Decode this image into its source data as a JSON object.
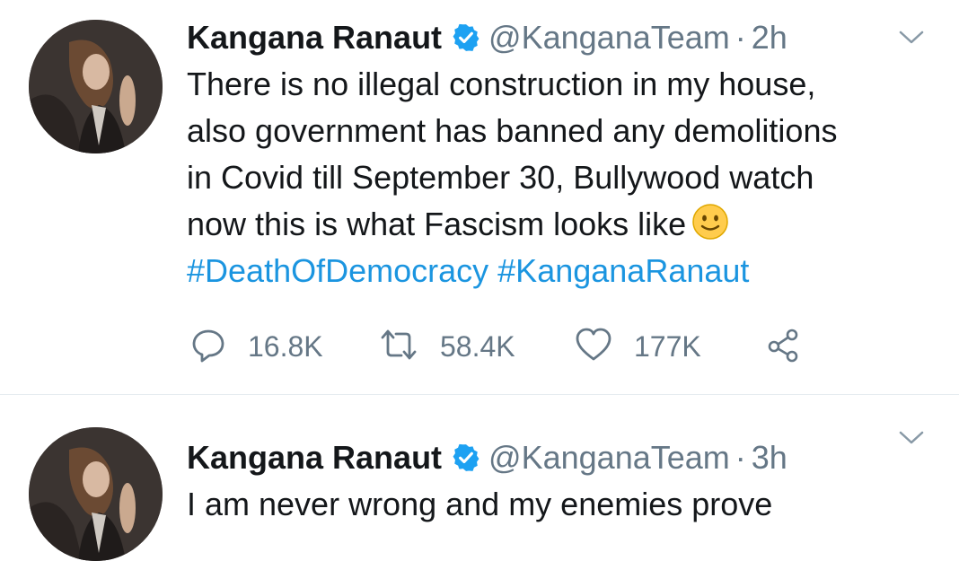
{
  "tweets": [
    {
      "author_name": "Kangana Ranaut",
      "handle": "@KanganaTeam",
      "separator": "·",
      "time": "2h",
      "lines": [
        "There is no illegal construction in my house,",
        "also government has banned any demolitions",
        "in Covid till September 30, Bullywood watch",
        "now this is what Fascism looks like"
      ],
      "emoji": "slightly-smiling-face",
      "hashtags": [
        "#DeathOfDemocracy",
        "#KanganaRanaut"
      ],
      "replies": "16.8K",
      "retweets": "58.4K",
      "likes": "177K"
    },
    {
      "author_name": "Kangana Ranaut",
      "handle": "@KanganaTeam",
      "separator": "·",
      "time": "3h",
      "lines": [
        "I am never wrong and my enemies prove"
      ]
    }
  ],
  "colors": {
    "hashtag": "#1b95e0",
    "muted": "#657786",
    "verified": "#1da1f2",
    "divider": "#e6ecf0"
  },
  "icons": [
    "verified-badge-icon",
    "chevron-down-icon",
    "reply-icon",
    "retweet-icon",
    "like-icon",
    "share-icon"
  ]
}
